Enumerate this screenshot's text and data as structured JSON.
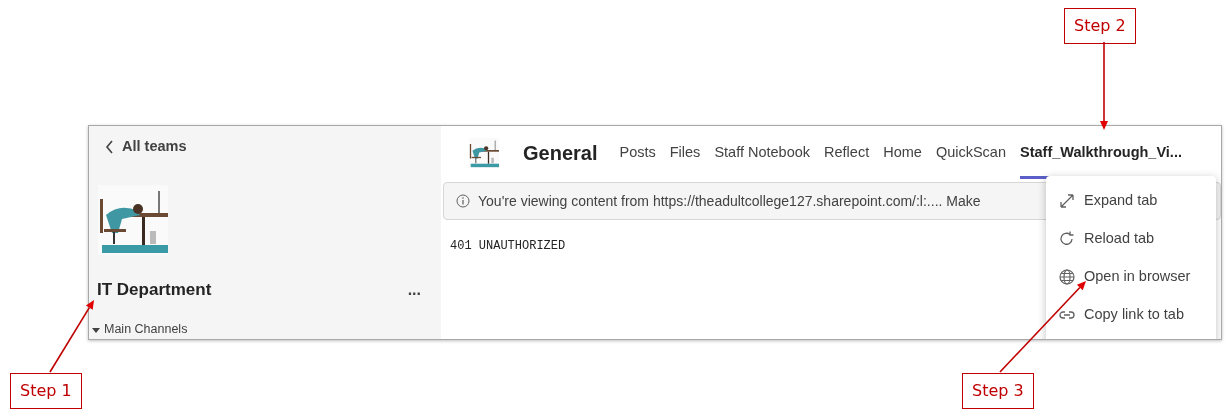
{
  "annotations": [
    {
      "label": "Step 2"
    },
    {
      "label": "Step 1"
    },
    {
      "label": "Step 3"
    }
  ],
  "sidebar": {
    "back_link": "All teams",
    "team_name": "IT Department",
    "more": "...",
    "section": "Main Channels",
    "section_expanded": true
  },
  "header": {
    "channel": "General",
    "tabs": [
      {
        "label": "Posts",
        "selected": false
      },
      {
        "label": "Files",
        "selected": false
      },
      {
        "label": "Staff Notebook",
        "selected": false
      },
      {
        "label": "Reflect",
        "selected": false
      },
      {
        "label": "Home",
        "selected": false
      },
      {
        "label": "QuickScan",
        "selected": false
      },
      {
        "label": "Staff_Walkthrough_Vi...",
        "selected": true
      }
    ]
  },
  "info_bar": {
    "text": "You're viewing content from https://theadultcollege127.sharepoint.com/:l:.... Make"
  },
  "content": "401 UNAUTHORIZED",
  "menu": {
    "items": [
      {
        "label": "Expand tab",
        "kind": "expand"
      },
      {
        "label": "Reload tab",
        "kind": "reload"
      },
      {
        "label": "Open in browser",
        "kind": "globe"
      },
      {
        "label": "Copy link to tab",
        "kind": "link"
      }
    ]
  }
}
